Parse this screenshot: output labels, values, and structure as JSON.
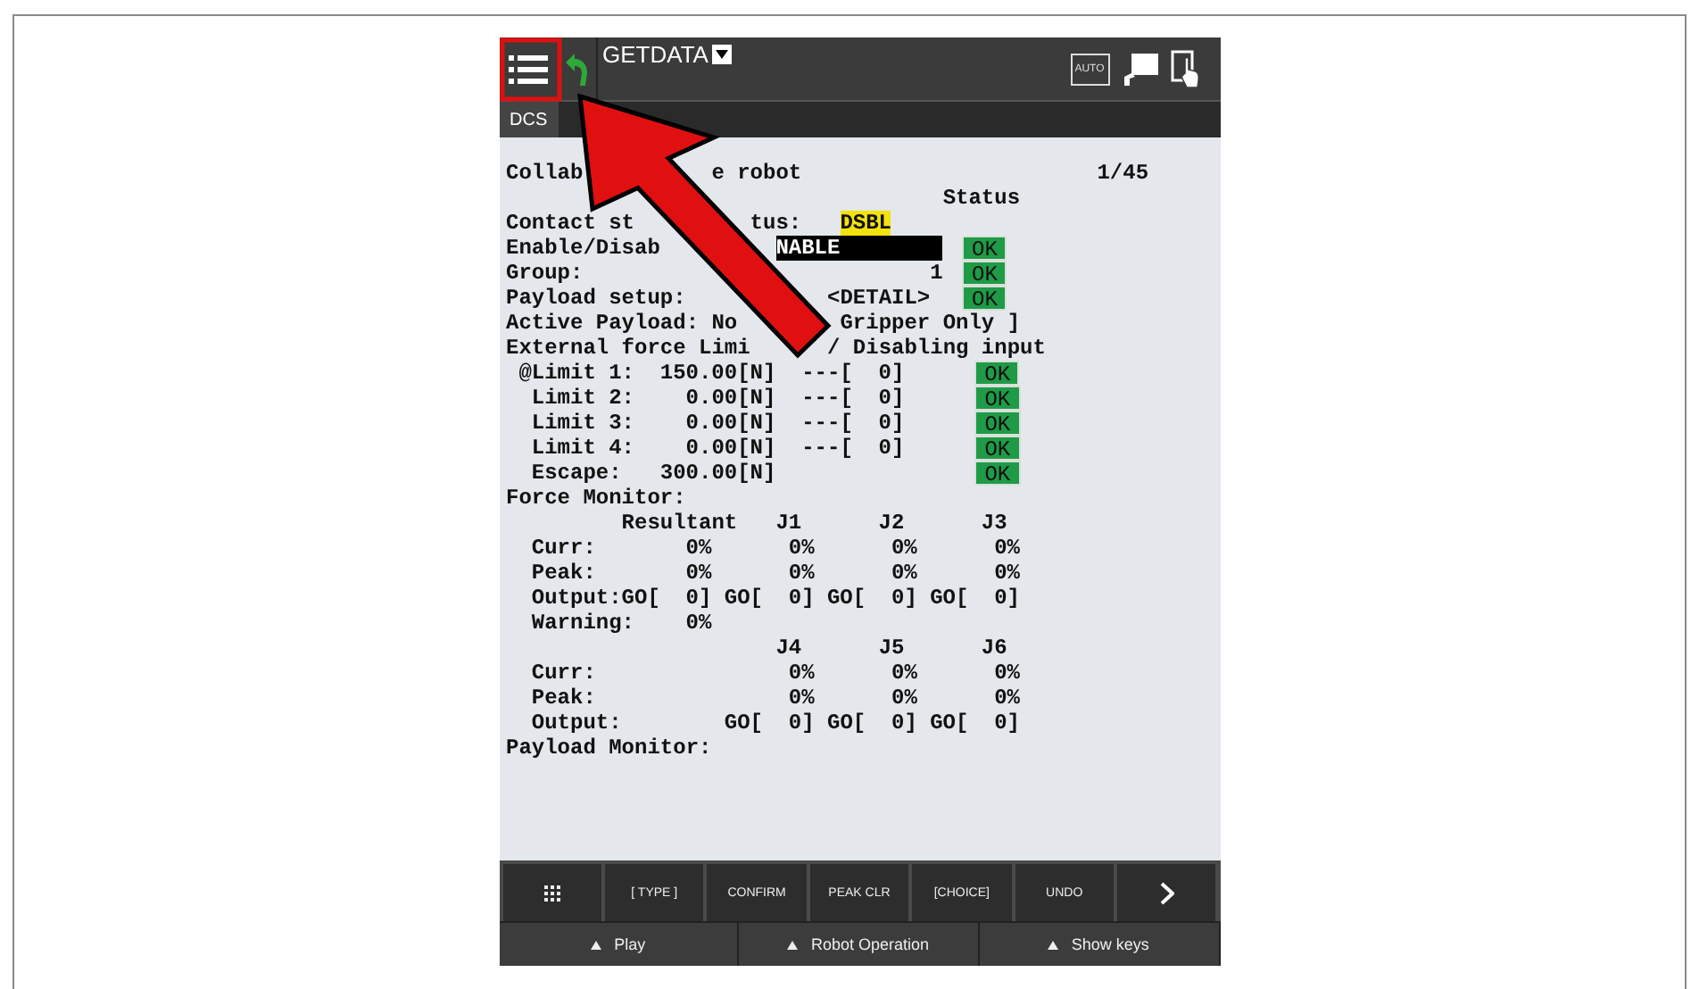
{
  "header": {
    "auto_label": "AUTO",
    "title": "GETDATA"
  },
  "breadcrumb": "DCS",
  "lines": [
    {
      "segments": [
        {
          "kind": "text",
          "text": "Collab"
        },
        {
          "kind": "text",
          "text": "e robot"
        },
        {
          "kind": "text",
          "text": "1/45"
        }
      ]
    },
    {
      "segments": [
        {
          "kind": "text",
          "text": "Status"
        }
      ]
    },
    {
      "segments": [
        {
          "kind": "text",
          "text": "Contact st"
        },
        {
          "kind": "text",
          "text": "tus:"
        },
        {
          "kind": "highlight",
          "text": "DSBL"
        }
      ]
    },
    {
      "segments": [
        {
          "kind": "text",
          "text": "Enable/Disab"
        },
        {
          "kind": "field",
          "text": "NABLE"
        },
        {
          "kind": "ok",
          "text": "OK"
        }
      ]
    },
    {
      "segments": [
        {
          "kind": "text",
          "text": "Group:"
        },
        {
          "kind": "text",
          "text": "1"
        },
        {
          "kind": "ok",
          "text": "OK"
        }
      ]
    },
    {
      "segments": [
        {
          "kind": "text",
          "text": "Payload setup:"
        },
        {
          "kind": "text",
          "text": "<DETAIL>"
        },
        {
          "kind": "ok",
          "text": "OK"
        }
      ]
    },
    {
      "segments": [
        {
          "kind": "text",
          "text": "Active Payload: No"
        },
        {
          "kind": "text",
          "text": "Gripper Only"
        },
        {
          "kind": "text",
          "text": "]"
        }
      ]
    },
    {
      "segments": [
        {
          "kind": "text",
          "text": "External force Limi"
        },
        {
          "kind": "text",
          "text": "/ Disabling input"
        }
      ]
    },
    {
      "segments": [
        {
          "kind": "text",
          "text": "@Limit 1:"
        },
        {
          "kind": "text",
          "text": "150.00[N]"
        },
        {
          "kind": "text",
          "text": "---[  0]"
        },
        {
          "kind": "ok",
          "text": "OK"
        }
      ]
    },
    {
      "segments": [
        {
          "kind": "text",
          "text": "Limit 2:"
        },
        {
          "kind": "text",
          "text": "0.00[N]"
        },
        {
          "kind": "text",
          "text": "---[  0]"
        },
        {
          "kind": "ok",
          "text": "OK"
        }
      ]
    },
    {
      "segments": [
        {
          "kind": "text",
          "text": "Limit 3:"
        },
        {
          "kind": "text",
          "text": "0.00[N]"
        },
        {
          "kind": "text",
          "text": "---[  0]"
        },
        {
          "kind": "ok",
          "text": "OK"
        }
      ]
    },
    {
      "segments": [
        {
          "kind": "text",
          "text": "Limit 4:"
        },
        {
          "kind": "text",
          "text": "0.00[N]"
        },
        {
          "kind": "text",
          "text": "---[  0]"
        },
        {
          "kind": "ok",
          "text": "OK"
        }
      ]
    },
    {
      "segments": [
        {
          "kind": "text",
          "text": "Escape:"
        },
        {
          "kind": "text",
          "text": "300.00[N]"
        },
        {
          "kind": "ok",
          "text": "OK"
        }
      ]
    },
    {
      "segments": [
        {
          "kind": "text",
          "text": "Force Monitor:"
        }
      ]
    },
    {
      "segments": [
        {
          "kind": "text",
          "text": "Resultant"
        },
        {
          "kind": "text",
          "text": "J1"
        },
        {
          "kind": "text",
          "text": "J2"
        },
        {
          "kind": "text",
          "text": "J3"
        }
      ]
    },
    {
      "segments": [
        {
          "kind": "text",
          "text": "Curr:"
        },
        {
          "kind": "text",
          "text": "0%"
        },
        {
          "kind": "text",
          "text": "0%"
        },
        {
          "kind": "text",
          "text": "0%"
        },
        {
          "kind": "text",
          "text": "0%"
        }
      ]
    },
    {
      "segments": [
        {
          "kind": "text",
          "text": "Peak:"
        },
        {
          "kind": "text",
          "text": "0%"
        },
        {
          "kind": "text",
          "text": "0%"
        },
        {
          "kind": "text",
          "text": "0%"
        },
        {
          "kind": "text",
          "text": "0%"
        }
      ]
    },
    {
      "segments": [
        {
          "kind": "text",
          "text": "Output:"
        },
        {
          "kind": "text",
          "text": "GO[  0]"
        },
        {
          "kind": "text",
          "text": "GO[  0]"
        },
        {
          "kind": "text",
          "text": "GO[  0]"
        },
        {
          "kind": "text",
          "text": "GO[  0]"
        }
      ]
    },
    {
      "segments": [
        {
          "kind": "text",
          "text": "Warning:"
        },
        {
          "kind": "text",
          "text": "0%"
        }
      ]
    },
    {
      "segments": [
        {
          "kind": "text",
          "text": "J4"
        },
        {
          "kind": "text",
          "text": "J5"
        },
        {
          "kind": "text",
          "text": "J6"
        }
      ]
    },
    {
      "segments": [
        {
          "kind": "text",
          "text": "Curr:"
        },
        {
          "kind": "text",
          "text": "0%"
        },
        {
          "kind": "text",
          "text": "0%"
        },
        {
          "kind": "text",
          "text": "0%"
        }
      ]
    },
    {
      "segments": [
        {
          "kind": "text",
          "text": "Peak:"
        },
        {
          "kind": "text",
          "text": "0%"
        },
        {
          "kind": "text",
          "text": "0%"
        },
        {
          "kind": "text",
          "text": "0%"
        }
      ]
    },
    {
      "segments": [
        {
          "kind": "text",
          "text": "Output:"
        },
        {
          "kind": "text",
          "text": "GO[  0]"
        },
        {
          "kind": "text",
          "text": "GO[  0]"
        },
        {
          "kind": "text",
          "text": "GO[  0]"
        }
      ]
    },
    {
      "segments": [
        {
          "kind": "text",
          "text": "Payload Monitor:"
        }
      ]
    }
  ],
  "function_keys": [
    {
      "kind": "grid"
    },
    {
      "kind": "label",
      "label": "[ TYPE ]"
    },
    {
      "kind": "label",
      "label": "CONFIRM"
    },
    {
      "kind": "label",
      "label": "PEAK CLR"
    },
    {
      "kind": "label",
      "label": "[CHOICE]"
    },
    {
      "kind": "label",
      "label": "UNDO"
    },
    {
      "kind": "next"
    }
  ],
  "bottom_bar": [
    "Play",
    "Robot Operation",
    "Show keys"
  ]
}
